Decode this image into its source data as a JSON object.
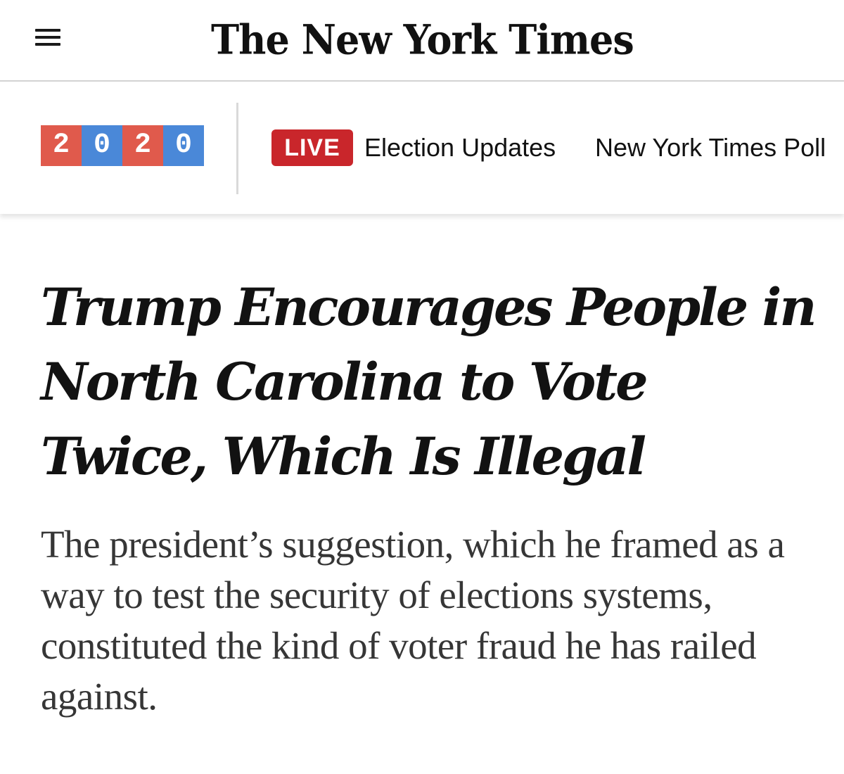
{
  "masthead": {
    "menu_icon": "hamburger-menu-icon",
    "logo_text": "The New York Times"
  },
  "election_nav": {
    "year_digits": [
      {
        "digit": "2",
        "color": "#e05a4c"
      },
      {
        "digit": "0",
        "color": "#4a88d8"
      },
      {
        "digit": "2",
        "color": "#e05a4c"
      },
      {
        "digit": "0",
        "color": "#4a88d8"
      }
    ],
    "live_label": "LIVE",
    "live_color": "#c9262b",
    "updates_link": "Election Updates",
    "poll_link": "New York Times Poll"
  },
  "article": {
    "headline": "Trump Encourages People in North Carolina to Vote Twice, Which Is Illegal",
    "summary": "The president’s suggestion, which he framed as a way to test the security of elections systems, constituted the kind of voter fraud he has railed against."
  }
}
